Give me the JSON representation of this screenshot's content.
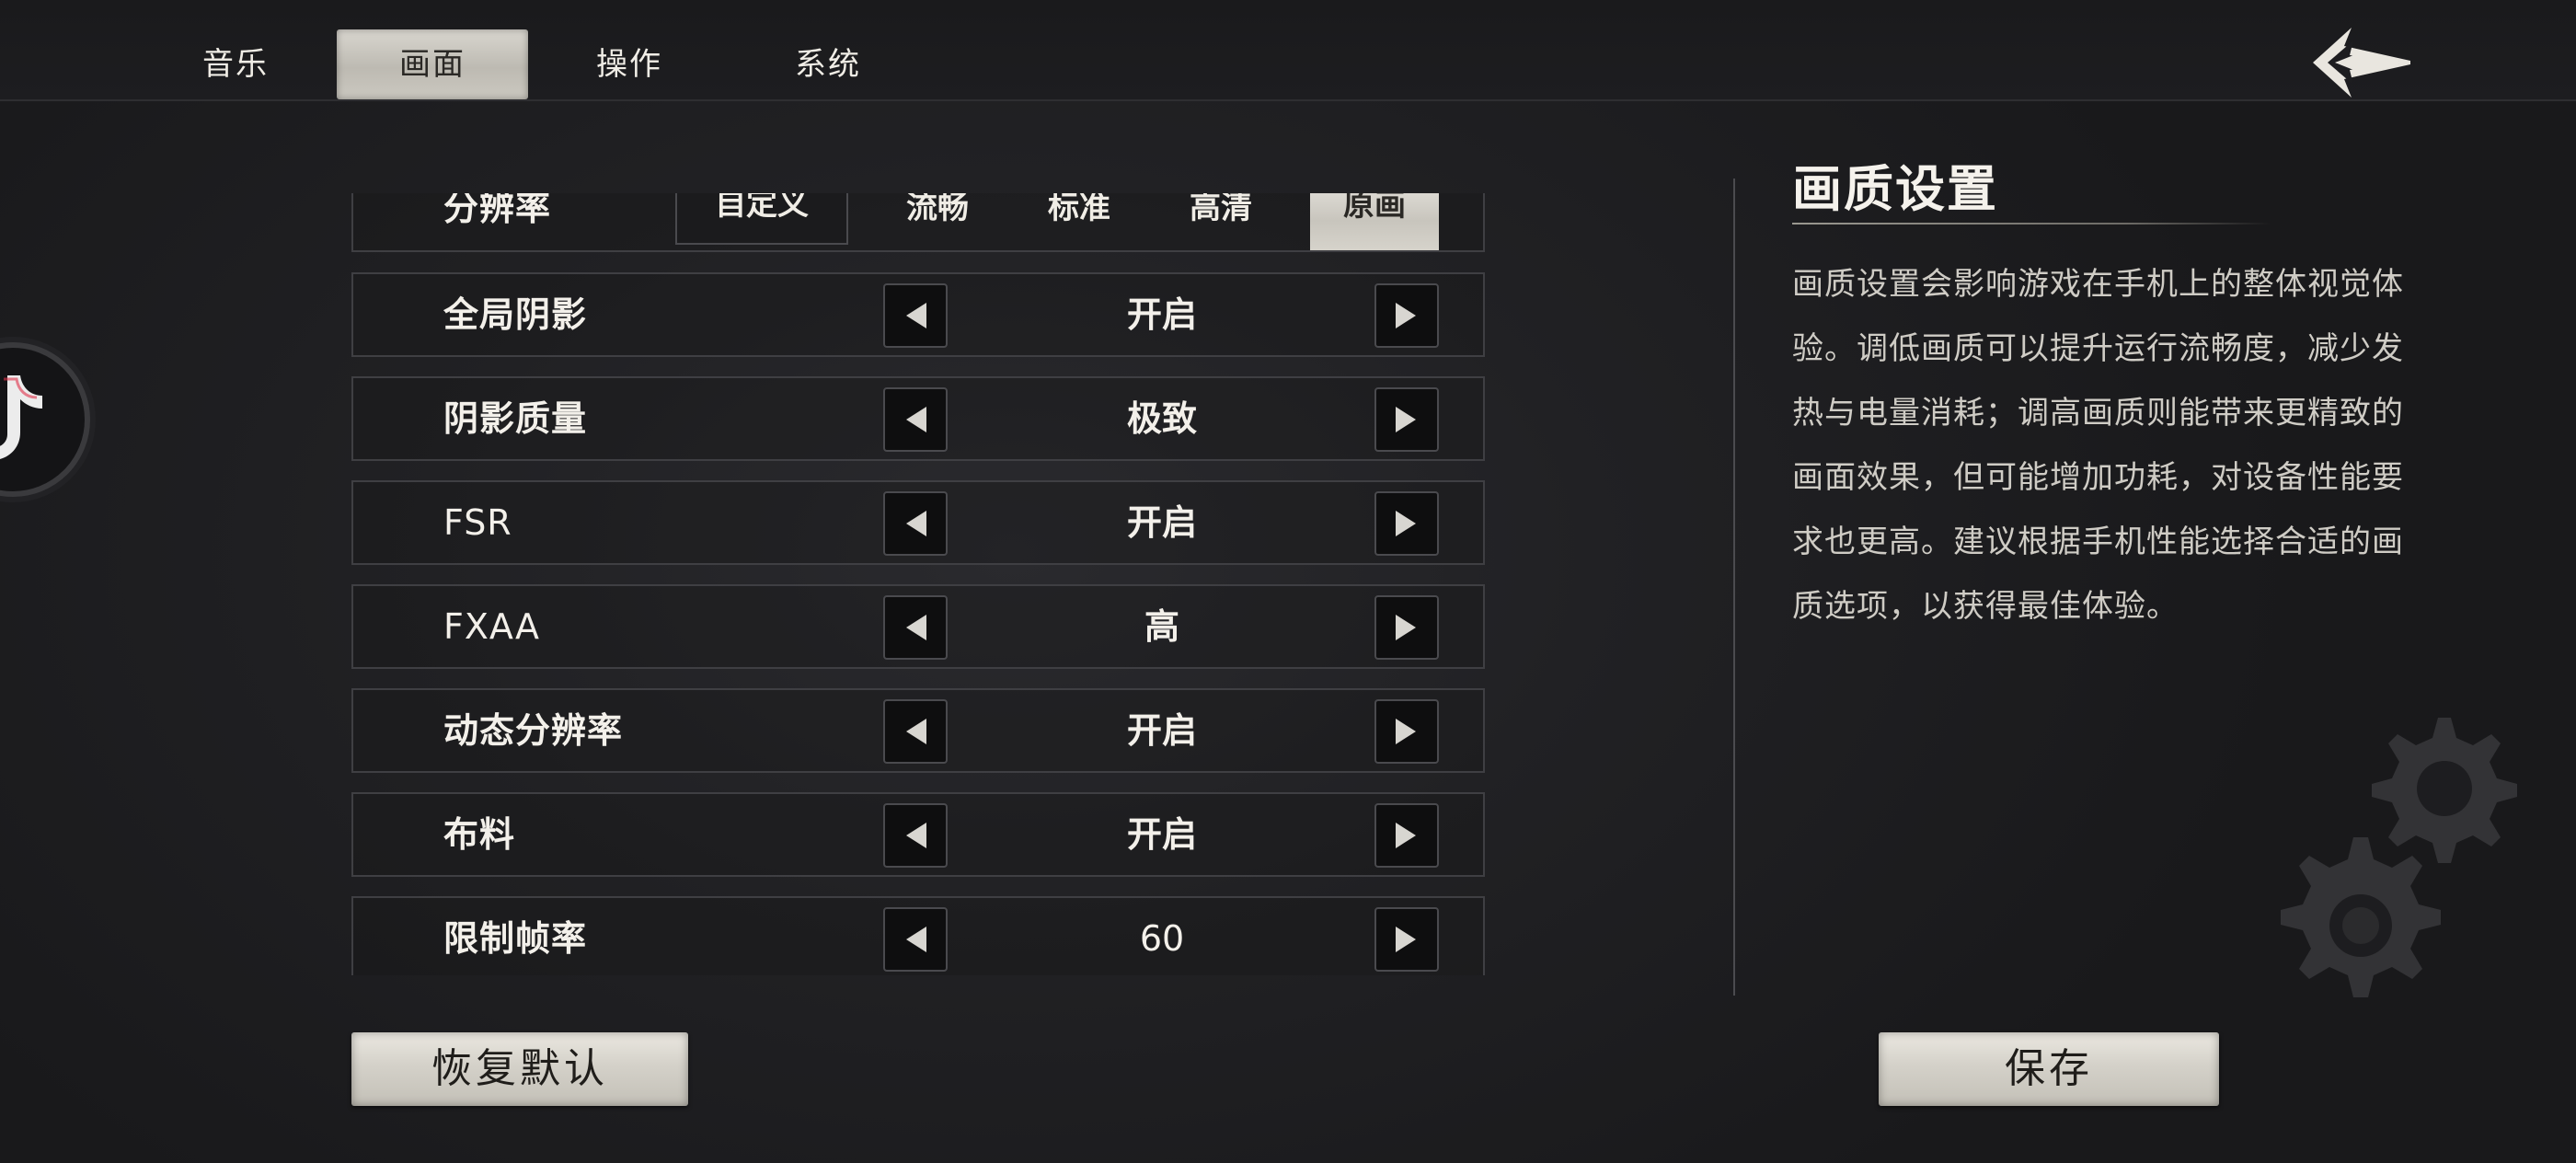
{
  "tabs": [
    {
      "label": "音乐",
      "active": false
    },
    {
      "label": "画面",
      "active": true
    },
    {
      "label": "操作",
      "active": false
    },
    {
      "label": "系统",
      "active": false
    }
  ],
  "back_icon": "back-arrow-icon",
  "resolution": {
    "label": "分辨率",
    "options": [
      "自定义",
      "流畅",
      "标准",
      "高清",
      "原画"
    ],
    "selected": "原画"
  },
  "settings": [
    {
      "label": "全局阴影",
      "value": "开启"
    },
    {
      "label": "阴影质量",
      "value": "极致"
    },
    {
      "label": "FSR",
      "value": "开启"
    },
    {
      "label": "FXAA",
      "value": "高"
    },
    {
      "label": "动态分辨率",
      "value": "开启"
    },
    {
      "label": "布料",
      "value": "开启"
    },
    {
      "label": "限制帧率",
      "value": "60"
    }
  ],
  "info": {
    "title": "画质设置",
    "description": "画质设置会影响游戏在手机上的整体视觉体验。调低画质可以提升运行流畅度，减少发热与电量消耗；调高画质则能带来更精致的画面效果，但可能增加功耗，对设备性能要求也更高。建议根据手机性能选择合适的画质选项，以获得最佳体验。"
  },
  "buttons": {
    "reset": "恢复默认",
    "save": "保存"
  },
  "colors": {
    "background": "#1d1d20",
    "active_tab": "#d4d1c9",
    "text": "#f3f0ea"
  }
}
